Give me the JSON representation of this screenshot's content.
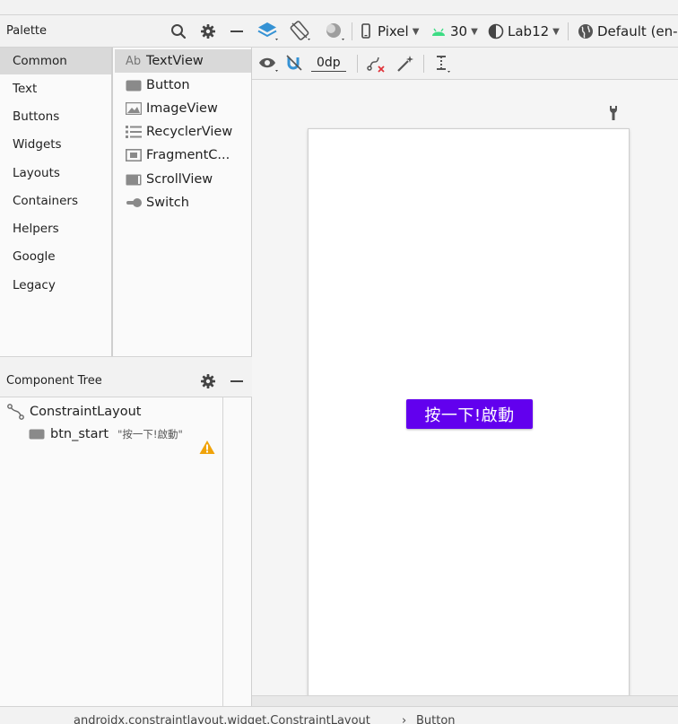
{
  "palette": {
    "title": "Palette",
    "categories": [
      "Common",
      "Text",
      "Buttons",
      "Widgets",
      "Layouts",
      "Containers",
      "Helpers",
      "Google",
      "Legacy"
    ],
    "selected_category": "Common",
    "widgets": [
      {
        "label": "TextView",
        "icon": "textview-icon",
        "icon_text": "Ab"
      },
      {
        "label": "Button",
        "icon": "button-icon"
      },
      {
        "label": "ImageView",
        "icon": "imageview-icon"
      },
      {
        "label": "RecyclerView",
        "icon": "recyclerview-icon"
      },
      {
        "label": "FragmentC...",
        "icon": "fragment-icon"
      },
      {
        "label": "ScrollView",
        "icon": "scrollview-icon"
      },
      {
        "label": "Switch",
        "icon": "switch-icon"
      }
    ],
    "selected_widget": "TextView"
  },
  "component_tree": {
    "title": "Component Tree",
    "root": {
      "label": "ConstraintLayout",
      "icon": "constraint-layout-icon"
    },
    "children": [
      {
        "label": "btn_start",
        "sub": "\"按一下!啟動\"",
        "icon": "button-icon",
        "warning": "warning-icon"
      }
    ]
  },
  "toolbar": {
    "device": "Pixel",
    "api": "30",
    "theme": "Lab12",
    "locale": "Default (en-u",
    "margin": "0dp"
  },
  "design": {
    "button_text": "按一下!啟動",
    "button_color": "#6200ee"
  },
  "breadcrumb": {
    "path": "androidx.constraintlayout.widget.ConstraintLayout",
    "separator": "›",
    "current": "Button"
  }
}
